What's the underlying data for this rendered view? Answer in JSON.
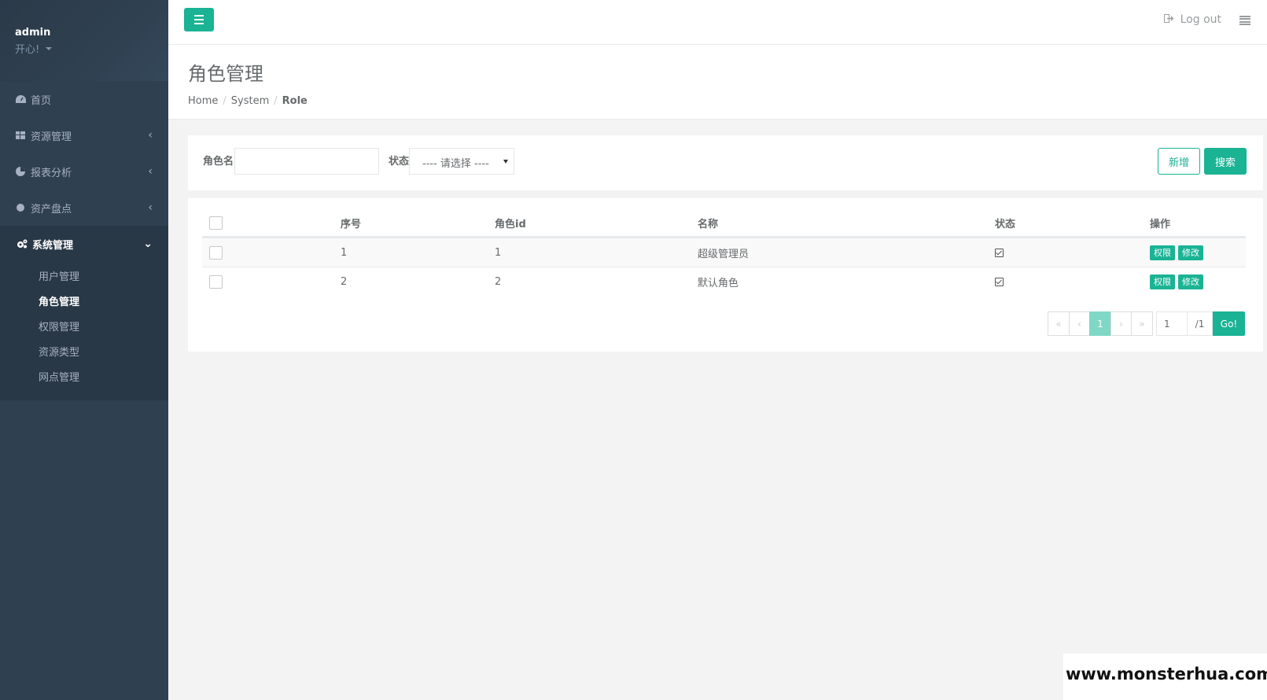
{
  "sidebar": {
    "user": "admin",
    "status": "开心!",
    "items": [
      {
        "label": "首页",
        "icon": "dashboard-icon",
        "chevron": ""
      },
      {
        "label": "资源管理",
        "icon": "grid-icon",
        "chevron": "‹"
      },
      {
        "label": "报表分析",
        "icon": "pie-chart-icon",
        "chevron": "‹"
      },
      {
        "label": "资产盘点",
        "icon": "circle-icon",
        "chevron": "‹"
      },
      {
        "label": "系统管理",
        "icon": "cogs-icon",
        "chevron": "⌄"
      }
    ],
    "subitems": [
      "用户管理",
      "角色管理",
      "权限管理",
      "资源类型",
      "网点管理"
    ]
  },
  "topbar": {
    "logout_label": "Log out"
  },
  "heading": {
    "title": "角色管理",
    "breadcrumb": [
      "Home",
      "System",
      "Role"
    ]
  },
  "search": {
    "name_label": "角色名",
    "name_value": "",
    "status_label": "状态",
    "status_selected": "---- 请选择 ----",
    "add_label": "新增",
    "search_label": "搜索"
  },
  "table": {
    "headers": [
      "序号",
      "角色id",
      "名称",
      "状态",
      "操作"
    ],
    "rows": [
      {
        "seq": "1",
        "id": "1",
        "name": "超级管理员",
        "enabled": true,
        "actions": [
          "权限",
          "修改"
        ]
      },
      {
        "seq": "2",
        "id": "2",
        "name": "默认角色",
        "enabled": true,
        "actions": [
          "权限",
          "修改"
        ]
      }
    ]
  },
  "pagination": {
    "first": "«",
    "prev": "‹",
    "current": "1",
    "next": "›",
    "last": "»",
    "page_input": "1",
    "total": "/1",
    "go_label": "Go!"
  },
  "watermark": "www.monsterhua.com",
  "colors": {
    "sidebar": "#2f4050",
    "accent": "#1ab394",
    "background": "#f3f3f4"
  }
}
